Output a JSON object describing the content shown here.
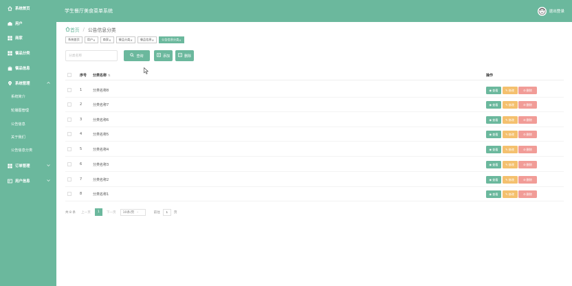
{
  "app": {
    "title": "学生餐厅美食菜单系统",
    "logout": "退出登录"
  },
  "sidebar": {
    "items": [
      {
        "label": "系统首页",
        "icon": "home-icon"
      },
      {
        "label": "用户",
        "icon": "user-icon"
      },
      {
        "label": "商家",
        "icon": "grid-icon"
      },
      {
        "label": "餐品分类",
        "icon": "grid-icon"
      },
      {
        "label": "餐品信息",
        "icon": "bag-icon"
      },
      {
        "label": "系统管理",
        "icon": "location-icon"
      }
    ],
    "sub_items": [
      "系统简介",
      "轮播图管理",
      "公告信息",
      "关于我们",
      "公告信息分类"
    ],
    "bottom_items": [
      {
        "label": "订单管理",
        "icon": "grid-icon"
      },
      {
        "label": "用户信息",
        "icon": "card-icon"
      }
    ]
  },
  "breadcrumb": {
    "home": "首页",
    "separator": "/",
    "current": "公告信息分类"
  },
  "tags": [
    {
      "label": "系统首页",
      "closable": false,
      "active": false
    },
    {
      "label": "用户",
      "closable": true,
      "active": false
    },
    {
      "label": "商家",
      "closable": true,
      "active": false
    },
    {
      "label": "餐品分类",
      "closable": true,
      "active": false
    },
    {
      "label": "餐品信息",
      "closable": true,
      "active": false
    },
    {
      "label": "公告信息分类",
      "closable": true,
      "active": true
    }
  ],
  "search": {
    "placeholder": "分类名称",
    "query_label": "查询"
  },
  "toolbar": {
    "add_label": "添加",
    "delete_label": "删除"
  },
  "table": {
    "headers": {
      "index": "序号",
      "name": "分类名称",
      "actions": "操作"
    },
    "rows": [
      {
        "index": "1",
        "name": "分类名称8"
      },
      {
        "index": "2",
        "name": "分类名称7"
      },
      {
        "index": "3",
        "name": "分类名称6"
      },
      {
        "index": "4",
        "name": "分类名称5"
      },
      {
        "index": "5",
        "name": "分类名称4"
      },
      {
        "index": "6",
        "name": "分类名称3"
      },
      {
        "index": "7",
        "name": "分类名称2"
      },
      {
        "index": "8",
        "name": "分类名称1"
      }
    ],
    "row_actions": {
      "view": "查看",
      "edit": "修改",
      "delete": "删除"
    }
  },
  "pagination": {
    "total": "共 8 条",
    "prev": "上一页",
    "current": "1",
    "next": "下一页",
    "page_size": "10条/页",
    "goto_label": "前往",
    "goto_value": "1",
    "goto_suffix": "页"
  },
  "colors": {
    "primary": "#6bb89d",
    "edit": "#f4c06e",
    "delete": "#f19c97"
  }
}
